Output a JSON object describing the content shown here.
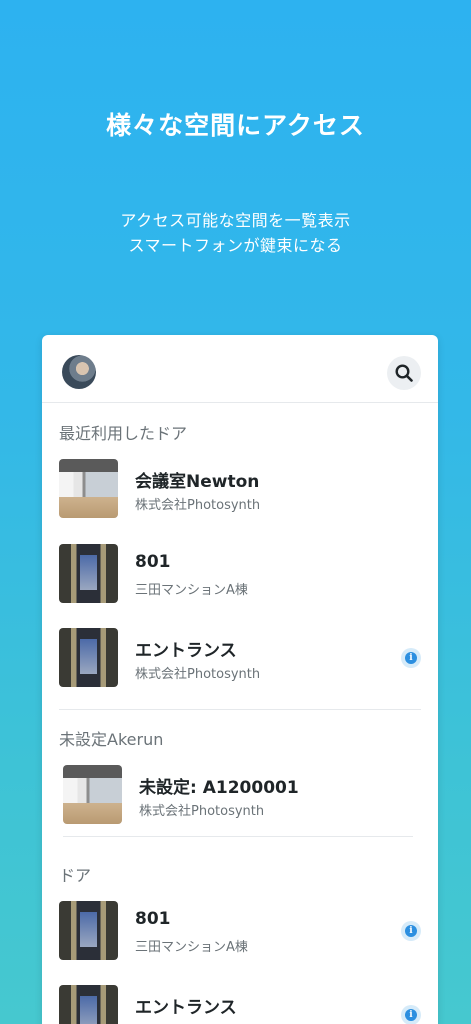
{
  "hero": {
    "title": "様々な空間にアクセス",
    "subtitle_line1": "アクセス可能な空間を一覧表示",
    "subtitle_line2": "スマートフォンが鍵束になる"
  },
  "header": {
    "avatar": "user-avatar",
    "search_icon": "search-icon"
  },
  "sections": {
    "recent": {
      "title": "最近利用したドア",
      "items": [
        {
          "name": "会議室Newton",
          "org": "株式会社Photosynth",
          "thumb": "room",
          "info": false
        },
        {
          "name": "801",
          "org": "三田マンションA棟",
          "thumb": "elevator",
          "info": false
        },
        {
          "name": "エントランス",
          "org": "株式会社Photosynth",
          "thumb": "elevator",
          "info": true
        }
      ]
    },
    "unset": {
      "title": "未設定Akerun",
      "items": [
        {
          "name": "未設定: A1200001",
          "org": "株式会社Photosynth",
          "thumb": "room",
          "info": false
        }
      ]
    },
    "doors": {
      "title": "ドア",
      "items": [
        {
          "name": "801",
          "org": "三田マンションA棟",
          "thumb": "elevator",
          "info": true
        },
        {
          "name": "エントランス",
          "org": "",
          "thumb": "elevator",
          "info": true
        }
      ]
    }
  },
  "colors": {
    "accent": "#2c8fe0",
    "background_top": "#2db2f0",
    "background_bottom": "#46c8cf"
  }
}
